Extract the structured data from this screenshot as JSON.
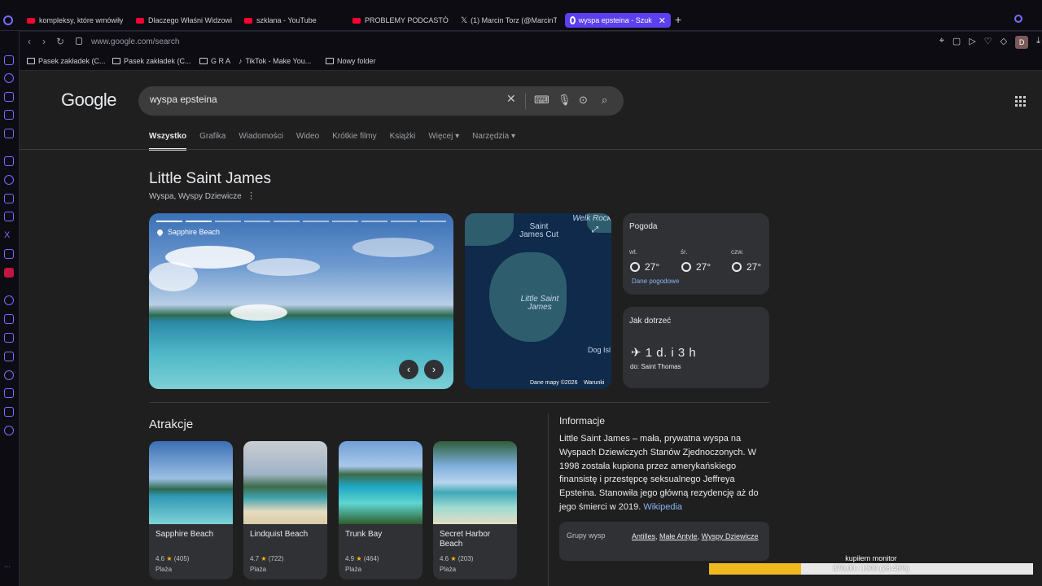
{
  "browser": {
    "tabs": [
      {
        "title": "kompleksy, które wmówiły",
        "icon": "youtube-icon"
      },
      {
        "title": "Dlaczego Właśni Widzowie",
        "icon": "youtube-icon"
      },
      {
        "title": "szklana - YouTube",
        "icon": "youtube-icon"
      },
      {
        "title": "PROBLEMY PODCASTÓW",
        "icon": "youtube-icon"
      },
      {
        "title": "(1) Marcin Torz (@MarcinT",
        "icon": "x-icon"
      },
      {
        "title": "wyspa epsteina - Szuk",
        "icon": "google-icon",
        "active": true
      }
    ],
    "new_tab": "+",
    "url": "www.google.com/search",
    "profile_initial": "D",
    "bookmarks": [
      "Pasek zakładek (C...",
      "Pasek zakładek (C...",
      "G R A",
      "TikTok - Make You...",
      "Nowy folder"
    ]
  },
  "search": {
    "logo": "Google",
    "query": "wyspa epsteina",
    "tabs": [
      "Wszystko",
      "Grafika",
      "Wiadomości",
      "Wideo",
      "Krótkie filmy",
      "Książki",
      "Więcej",
      "Narzędzia"
    ],
    "active_tab": "Wszystko"
  },
  "knowledge_panel": {
    "title": "Little Saint James",
    "subtitle": "Wyspa, Wyspy Dziewicze",
    "photo_location": "Sapphire Beach",
    "photo_nav": {
      "prev": "‹",
      "next": "›"
    },
    "map": {
      "labels": [
        "Saint James Cut",
        "Welk Rock",
        "Little Saint James",
        "Dog Isl"
      ],
      "credit": "Dane mapy ©2026",
      "terms": "Warunki"
    },
    "weather": {
      "title": "Pogoda",
      "days": [
        {
          "day": "wt.",
          "temp": "27°",
          "icon": "partly-cloudy-icon"
        },
        {
          "day": "śr.",
          "temp": "27°",
          "icon": "partly-cloudy-icon"
        },
        {
          "day": "czw.",
          "temp": "27°",
          "icon": "sun-icon"
        }
      ],
      "link": "Dane pogodowe"
    },
    "travel": {
      "title": "Jak dotrzeć",
      "time": "✈ 1 d. i 3 h",
      "destination": "do: Saint Thomas"
    },
    "attractions": {
      "title": "Atrakcje",
      "items": [
        {
          "name": "Sapphire Beach",
          "rating": "4.6",
          "reviews": "(405)",
          "type": "Plaża"
        },
        {
          "name": "Lindquist Beach",
          "rating": "4.7",
          "reviews": "(722)",
          "type": "Plaża"
        },
        {
          "name": "Trunk Bay",
          "rating": "4.9",
          "reviews": "(464)",
          "type": "Plaża"
        },
        {
          "name": "Secret Harbor Beach",
          "rating": "4.6",
          "reviews": "(203)",
          "type": "Plaża"
        }
      ]
    },
    "info": {
      "title": "Informacje",
      "text": "Little Saint James – mała, prywatna wyspa na Wyspach Dziewiczych Stanów Zjednoczonych. W 1998 została kupiona przez amerykańskiego finansistę i przestępcę seksualnego Jeffreya Epsteina. Stanowiła jego główną rezydencję aż do jego śmierci w 2019.",
      "link": "Wikipedia",
      "group_label": "Grupy wysp",
      "group_values": [
        "Antilles",
        "Małe Antyle",
        "Wyspy Dziewicze"
      ]
    }
  },
  "overlay": {
    "label": "kupiłem monitor",
    "progress_text": "370.00 / 1300 (28.46%)",
    "progress": 0.2846
  }
}
